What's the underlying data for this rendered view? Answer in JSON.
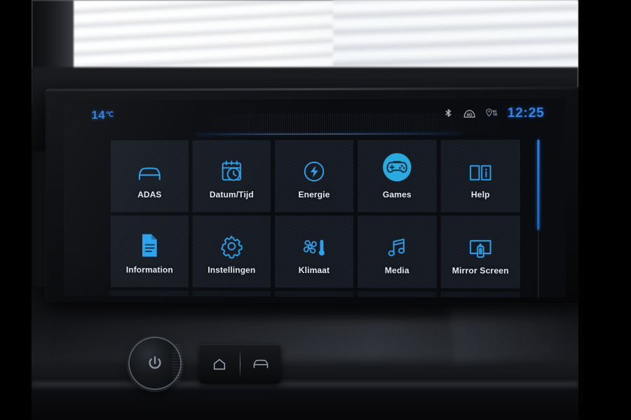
{
  "device": {
    "type": "car-infotainment-head-unit",
    "accent_blue": "#2f7fe0",
    "icon_blue": "#2aa3ef",
    "tile_bg": "#161b23",
    "screen_bg": "#0a0c10"
  },
  "status_bar": {
    "temperature_value": "14",
    "temperature_unit": "℃",
    "icons": [
      {
        "name": "bluetooth-icon",
        "label": "Bluetooth"
      },
      {
        "name": "network-4g-icon",
        "label": "4G"
      },
      {
        "name": "location-data-icon",
        "label": "GPS data transfer"
      }
    ],
    "clock": "12:25"
  },
  "app_grid": {
    "columns": 5,
    "rows_visible": 2,
    "tiles": [
      {
        "label": "ADAS",
        "icon": "car-icon",
        "highlighted": false
      },
      {
        "label": "Datum/Tijd",
        "icon": "calendar-clock-icon",
        "highlighted": false
      },
      {
        "label": "Energie",
        "icon": "energy-bolt-icon",
        "highlighted": false
      },
      {
        "label": "Games",
        "icon": "gamepad-icon",
        "highlighted": true
      },
      {
        "label": "Help",
        "icon": "book-info-icon",
        "highlighted": false
      },
      {
        "label": "Information",
        "icon": "document-icon",
        "highlighted": false
      },
      {
        "label": "Instellingen",
        "icon": "gear-icon",
        "highlighted": false
      },
      {
        "label": "Klimaat",
        "icon": "fan-thermometer-icon",
        "highlighted": false
      },
      {
        "label": "Media",
        "icon": "music-note-icon",
        "highlighted": false
      },
      {
        "label": "Mirror Screen",
        "icon": "screen-mirror-icon",
        "highlighted": false
      }
    ]
  },
  "scrollbar": {
    "orientation": "vertical",
    "thumb_position_percent": 0,
    "thumb_size_percent": 57
  },
  "hardware_controls": [
    {
      "name": "power-volume-knob",
      "icon": "power-icon"
    },
    {
      "name": "home-button",
      "icon": "home-icon"
    },
    {
      "name": "vehicle-button",
      "icon": "car-icon"
    }
  ]
}
